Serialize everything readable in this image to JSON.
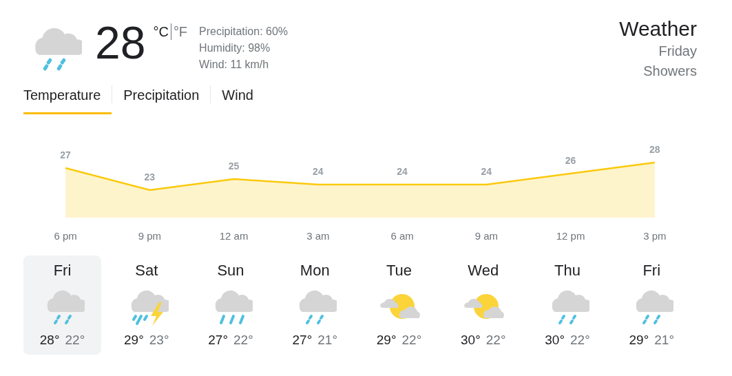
{
  "current": {
    "kind": "rain",
    "temperature": "28",
    "unit_c": "°C",
    "unit_f": "°F",
    "unit_c_selected": true,
    "details": [
      "Precipitation: 60%",
      "Humidity: 98%",
      "Wind: 11 km/h"
    ]
  },
  "location": {
    "title": "Weather",
    "day": "Friday",
    "condition": "Showers"
  },
  "tabs": [
    {
      "label": "Temperature",
      "selected": true
    },
    {
      "label": "Precipitation",
      "selected": false
    },
    {
      "label": "Wind",
      "selected": false
    }
  ],
  "chart_data": {
    "type": "area",
    "categories": [
      "6 pm",
      "9 pm",
      "12 am",
      "3 am",
      "6 am",
      "9 am",
      "12 pm",
      "3 pm"
    ],
    "series": [
      {
        "color": "#fbc90b",
        "values": [
          27,
          23,
          25,
          24,
          24,
          24,
          26,
          28
        ]
      }
    ],
    "data_labels": true
  },
  "days": [
    {
      "name": "Fri",
      "kind": "rain",
      "high": "28°",
      "low": "22°",
      "selected": true
    },
    {
      "name": "Sat",
      "kind": "thunderstorm",
      "high": "29°",
      "low": "23°",
      "selected": false
    },
    {
      "name": "Sun",
      "kind": "heavy-rain",
      "high": "27°",
      "low": "22°",
      "selected": false
    },
    {
      "name": "Mon",
      "kind": "rain",
      "high": "27°",
      "low": "21°",
      "selected": false
    },
    {
      "name": "Tue",
      "kind": "partly-cloudy",
      "high": "29°",
      "low": "22°",
      "selected": false
    },
    {
      "name": "Wed",
      "kind": "partly-cloudy",
      "high": "30°",
      "low": "22°",
      "selected": false
    },
    {
      "name": "Thu",
      "kind": "rain",
      "high": "30°",
      "low": "22°",
      "selected": false
    },
    {
      "name": "Fri",
      "kind": "rain",
      "high": "29°",
      "low": "21°",
      "selected": false
    }
  ]
}
